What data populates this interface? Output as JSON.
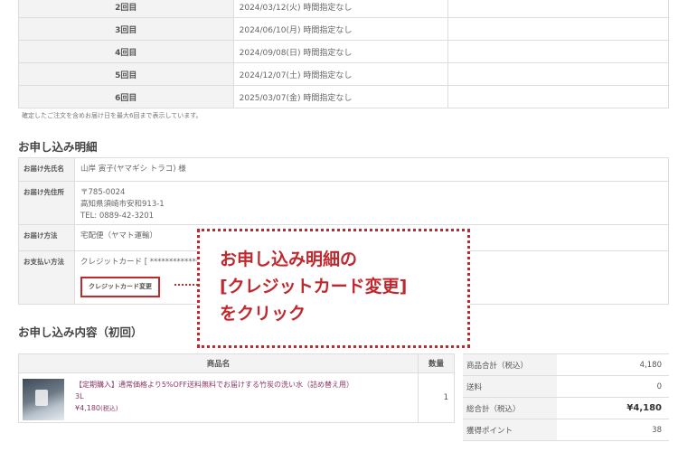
{
  "schedule": {
    "rows": [
      {
        "round": "2回目",
        "date": "2024/03/12(火) 時間指定なし"
      },
      {
        "round": "3回目",
        "date": "2024/06/10(月) 時間指定なし"
      },
      {
        "round": "4回目",
        "date": "2024/09/08(日) 時間指定なし"
      },
      {
        "round": "5回目",
        "date": "2024/12/07(土) 時間指定なし"
      },
      {
        "round": "6回目",
        "date": "2025/03/07(金) 時間指定なし"
      }
    ],
    "note": "確定したご注文を含めお届け日を最大6回まで表示しています。"
  },
  "details": {
    "heading": "お申し込み明細",
    "recipient_label": "お届け先氏名",
    "recipient_value": "山岸 寅子(ヤマギシ トラコ) 様",
    "address_label": "お届け先住所",
    "postal": "〒785-0024",
    "address": "高知県須崎市安和913-1",
    "tel": "TEL: 0889-42-3201",
    "method_label": "お届け方法",
    "method_value": "宅配便（ヤマト運輸）",
    "payment_label": "お支払い方法",
    "payment_value": "クレジットカード [ ****************",
    "change_card_button": "クレジットカード変更"
  },
  "contents": {
    "heading": "お申し込み内容（初回）",
    "col_product": "商品名",
    "col_qty": "数量",
    "product_name": "【定期購入】通常価格より5%OFF送料無料でお届けする竹炭の洗い水（詰め替え用）",
    "product_size": "3L",
    "product_price": "¥4,180",
    "product_tax": "(税込)",
    "quantity": "1"
  },
  "summary": {
    "rows": [
      {
        "label": "商品合計（税込）",
        "value": "4,180"
      },
      {
        "label": "送料",
        "value": "0"
      },
      {
        "label": "総合計（税込）",
        "value": "¥4,180"
      },
      {
        "label": "獲得ポイント",
        "value": "38"
      }
    ]
  },
  "callout": {
    "line1": "お申し込み明細の",
    "line2": "[クレジットカード変更]",
    "line3": "をクリック"
  },
  "colors": {
    "accent": "#c0282d",
    "product_link": "#8a3a66"
  }
}
